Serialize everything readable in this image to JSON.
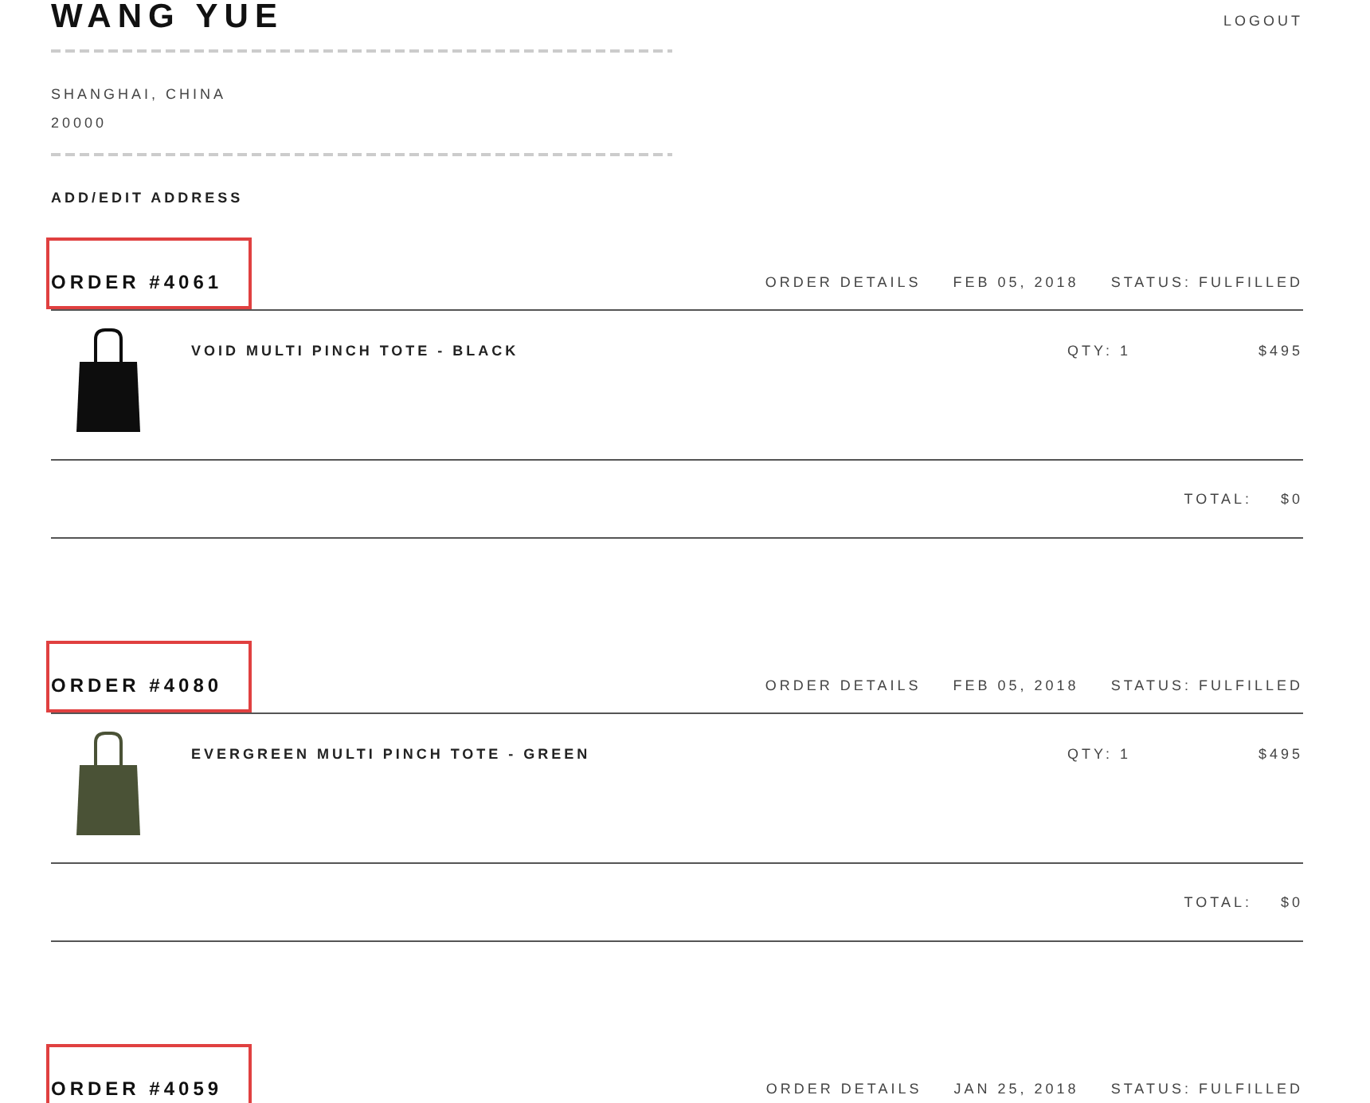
{
  "account": {
    "name": "WANG YUE",
    "logout": "LOGOUT",
    "address_lines": [
      {
        "kind": "redacted"
      },
      {
        "kind": "text",
        "text": "SHANGHAI, CHINA"
      },
      {
        "kind": "text",
        "text": "20000"
      },
      {
        "kind": "redacted"
      }
    ],
    "edit_link": "ADD/EDIT ADDRESS"
  },
  "orders": [
    {
      "number": "ORDER #4061",
      "highlighted": true,
      "details_link": "ORDER DETAILS",
      "date": "FEB 05, 2018",
      "status": "STATUS: FULFILLED",
      "items": [
        {
          "name": "VOID MULTI PINCH TOTE - BLACK",
          "qty": "QTY: 1",
          "price": "$495",
          "color": "#0d0d0d"
        }
      ],
      "total_label": "TOTAL:",
      "total": "$0"
    },
    {
      "number": "ORDER #4080",
      "highlighted": true,
      "details_link": "ORDER DETAILS",
      "date": "FEB 05, 2018",
      "status": "STATUS: FULFILLED",
      "items": [
        {
          "name": "EVERGREEN MULTI PINCH TOTE - GREEN",
          "qty": "QTY: 1",
          "price": "$495",
          "color": "#4a5236"
        }
      ],
      "total_label": "TOTAL:",
      "total": "$0"
    },
    {
      "number": "ORDER #4059",
      "highlighted": true,
      "details_link": "ORDER DETAILS",
      "date": "JAN 25, 2018",
      "status": "STATUS: FULFILLED"
    }
  ]
}
